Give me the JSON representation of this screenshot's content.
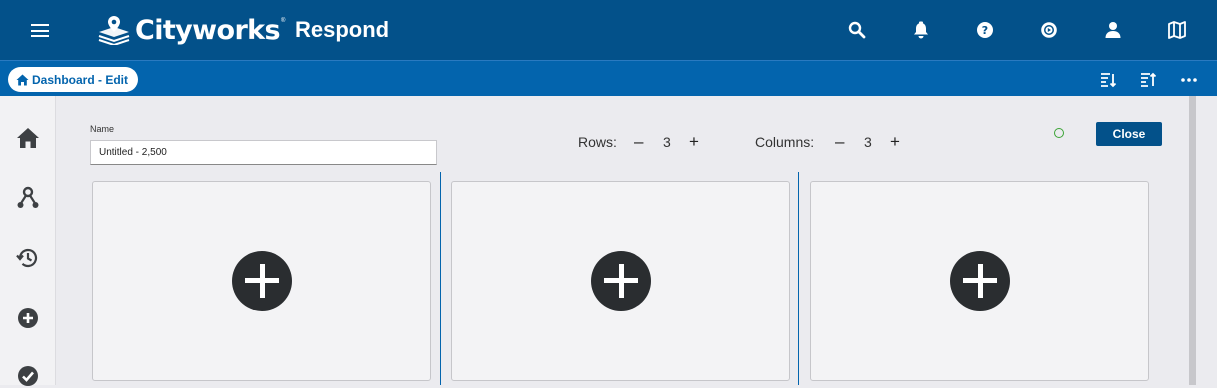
{
  "header": {
    "brand": "Cityworks",
    "brand_tm": "®",
    "app_name": "Respond",
    "icons": [
      "menu-icon",
      "search-icon",
      "notifications-bell-icon",
      "help-icon",
      "settings-icon",
      "user-icon",
      "map-icon"
    ]
  },
  "subbar": {
    "breadcrumb": "Dashboard - Edit",
    "icons": [
      "sort-descending-icon",
      "sort-ascending-icon",
      "more-options-icon"
    ]
  },
  "sidebar": {
    "items": [
      "home-icon",
      "workflow-icon",
      "history-icon",
      "add-icon",
      "check-icon"
    ]
  },
  "editor": {
    "name_label": "Name",
    "name_value": "Untitled - 2,500",
    "rows_label": "Rows:",
    "rows_value": "3",
    "columns_label": "Columns:",
    "columns_value": "3",
    "minus": "–",
    "plus": "+",
    "close_label": "Close",
    "status_color": "#3aa335"
  },
  "panels": [
    {
      "action": "add-widget"
    },
    {
      "action": "add-widget"
    },
    {
      "action": "add-widget"
    }
  ],
  "colors": {
    "header_bg": "#03518a",
    "subbar_bg": "#0364ad",
    "accent": "#0364ad"
  }
}
